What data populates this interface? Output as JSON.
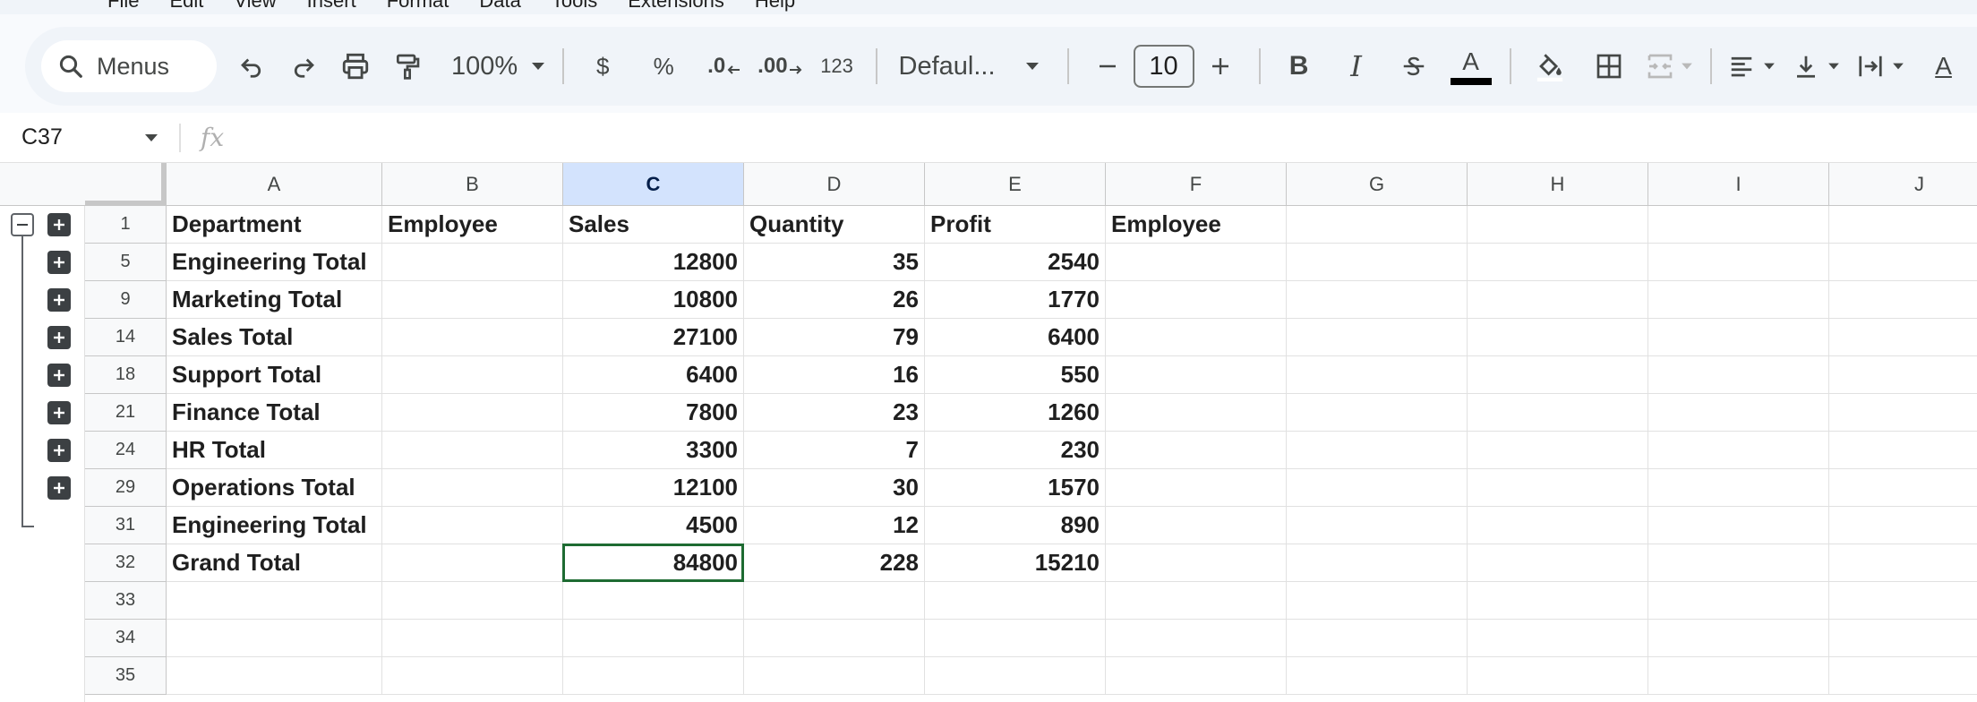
{
  "menu": [
    "File",
    "Edit",
    "View",
    "Insert",
    "Format",
    "Data",
    "Tools",
    "Extensions",
    "Help"
  ],
  "toolbar": {
    "search_label": "Menus",
    "zoom": "100%",
    "currency_symbol": "$",
    "percent_symbol": "%",
    "decrease_decimal": ".0",
    "increase_decimal": ".00",
    "number_format": "123",
    "font_family": "Defaul...",
    "font_size": "10",
    "bold": "B",
    "italic": "I",
    "text_color": "A",
    "text_color_value": "#000000"
  },
  "formula_bar": {
    "cell_ref": "C37",
    "fx_label": "fx",
    "value": ""
  },
  "columns": [
    "A",
    "B",
    "C",
    "D",
    "E",
    "F",
    "G",
    "H",
    "I",
    "J"
  ],
  "selected_column": "C",
  "rows": [
    {
      "num": "1",
      "cells": [
        "Department",
        "Employee",
        "Sales",
        "Quantity",
        "Profit",
        "Employee"
      ],
      "group": "minus"
    },
    {
      "num": "5",
      "cells": [
        "Engineering Total",
        "",
        "12800",
        "35",
        "2540",
        ""
      ],
      "group": "plus"
    },
    {
      "num": "9",
      "cells": [
        "Marketing Total",
        "",
        "10800",
        "26",
        "1770",
        ""
      ],
      "group": "plus"
    },
    {
      "num": "14",
      "cells": [
        "Sales Total",
        "",
        "27100",
        "79",
        "6400",
        ""
      ],
      "group": "plus"
    },
    {
      "num": "18",
      "cells": [
        "Support Total",
        "",
        "6400",
        "16",
        "550",
        ""
      ],
      "group": "plus"
    },
    {
      "num": "21",
      "cells": [
        "Finance Total",
        "",
        "7800",
        "23",
        "1260",
        ""
      ],
      "group": "plus"
    },
    {
      "num": "24",
      "cells": [
        "HR Total",
        "",
        "3300",
        "7",
        "230",
        ""
      ],
      "group": "plus"
    },
    {
      "num": "29",
      "cells": [
        "Operations Total",
        "",
        "12100",
        "30",
        "1570",
        ""
      ],
      "group": "plus"
    },
    {
      "num": "31",
      "cells": [
        "Engineering Total",
        "",
        "4500",
        "12",
        "890",
        ""
      ],
      "group": ""
    },
    {
      "num": "32",
      "cells": [
        "Grand Total",
        "",
        "84800",
        "228",
        "15210",
        ""
      ],
      "group": ""
    },
    {
      "num": "33",
      "cells": [
        "",
        "",
        "",
        "",
        "",
        ""
      ],
      "group": ""
    },
    {
      "num": "34",
      "cells": [
        "",
        "",
        "",
        "",
        "",
        ""
      ],
      "group": ""
    },
    {
      "num": "35",
      "cells": [
        "",
        "",
        "",
        "",
        "",
        ""
      ],
      "group": ""
    }
  ],
  "active_cell": {
    "row": "32",
    "col": "C"
  },
  "colors": {
    "selection_border": "#1e6b32",
    "selected_header": "#d3e3fd",
    "toolbar_bg": "#f0f4f9"
  }
}
